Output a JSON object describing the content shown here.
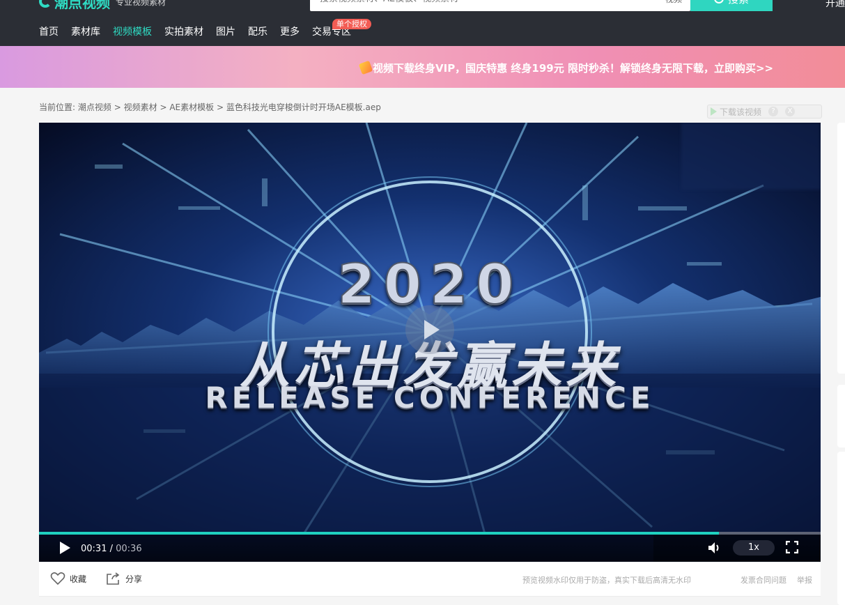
{
  "header": {
    "logo_text": "潮点视频",
    "logo_sub": "专业视频素材",
    "search_placeholder": "搜索视频素材、AE模板、视频素材",
    "search_type": "视频",
    "search_button": "搜索",
    "right_link": "开通"
  },
  "nav": {
    "items": [
      "首页",
      "素材库",
      "视频模板",
      "实拍素材",
      "图片",
      "配乐",
      "更多",
      "交易专区"
    ],
    "active": "视频模板",
    "badge": "单个授权"
  },
  "banner": {
    "text": "视频下载终身VIP，国庆特惠 终身199元 限时秒杀！解锁终身无限下载，立即购买>>"
  },
  "breadcrumb": {
    "prefix": "当前位置:",
    "items": [
      "潮点视频",
      "视频素材",
      "AE素材模板",
      "蓝色科技光电穿梭倒计时开场AE模板.aep"
    ],
    "separator": ">"
  },
  "download_tip": {
    "text": "下载该视频",
    "help": "?",
    "close": "X"
  },
  "video": {
    "year": "2020",
    "title": "从芯出发赢未来",
    "subtitle": "RELEASE CONFERENCE",
    "current_time": "00:31",
    "total_time": "00:36",
    "progress": 0.87,
    "speed": "1x"
  },
  "actions": {
    "favorite": "收藏",
    "share": "分享",
    "notice": "预览视频水印仅用于防盗，真实下载后高清无水印",
    "invoice": "发票合同问题",
    "report": "举报"
  },
  "colors": {
    "accent": "#2fdbc3",
    "header_bg": "#2b2e35",
    "badge": "#f25c54"
  }
}
